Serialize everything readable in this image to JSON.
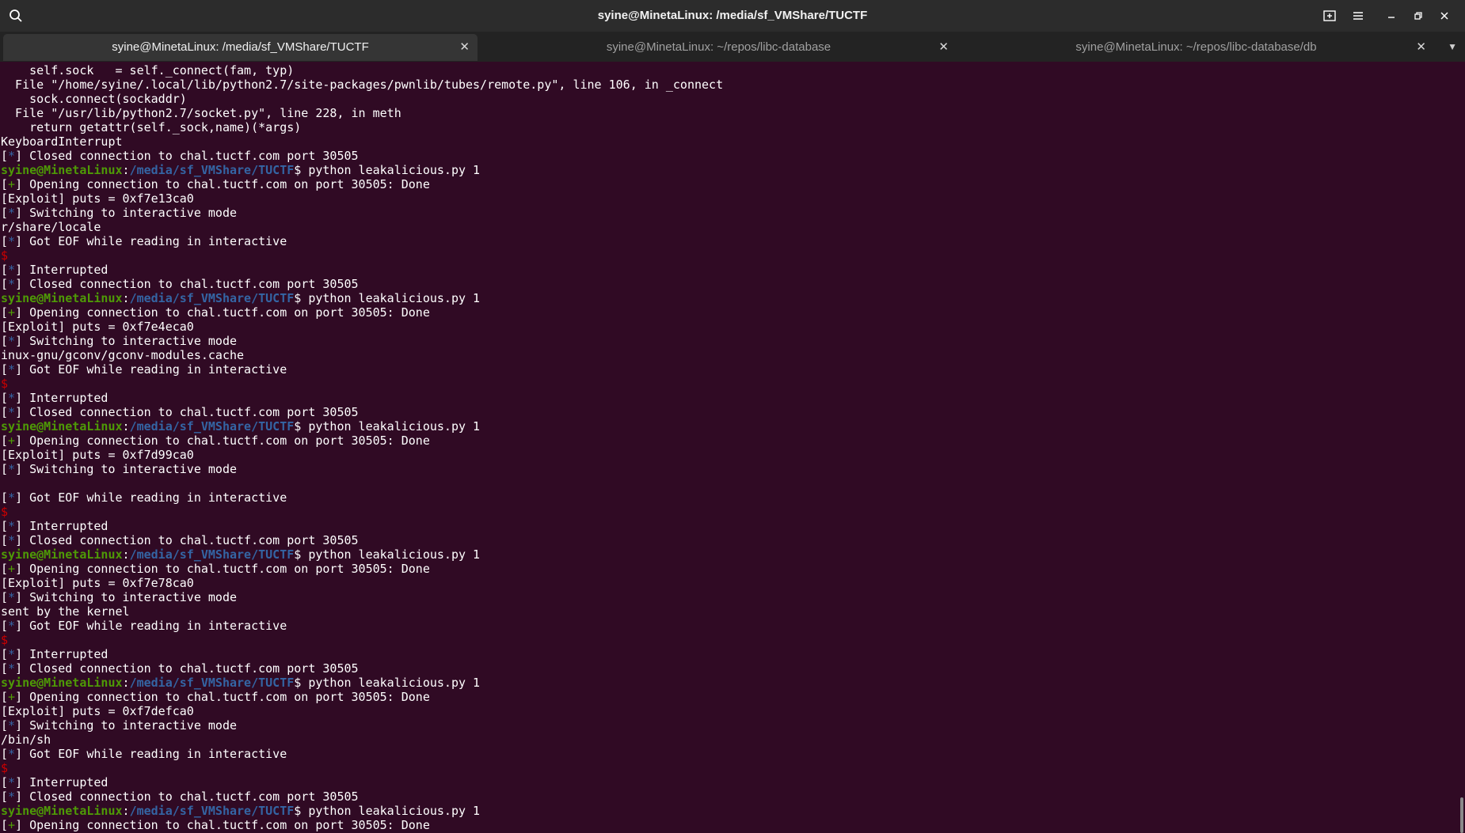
{
  "window": {
    "title": "syine@MinetaLinux: /media/sf_VMShare/TUCTF"
  },
  "icons": {
    "search": "search-icon",
    "new_tab": "new-tab-icon",
    "menu": "hamburger-menu-icon",
    "minimize": "minimize-icon",
    "maximize": "maximize-icon",
    "close": "close-icon",
    "tab_list": "chevron-down-icon"
  },
  "tabs": [
    {
      "label": "syine@MinetaLinux: /media/sf_VMShare/TUCTF",
      "active": true
    },
    {
      "label": "syine@MinetaLinux: ~/repos/libc-database",
      "active": false
    },
    {
      "label": "syine@MinetaLinux: ~/repos/libc-database/db",
      "active": false
    }
  ],
  "colors": {
    "background": "#300a24",
    "prompt_user": "#4e9a06",
    "prompt_path": "#3465a4",
    "status_plus": "#4e9a06",
    "status_star": "#3465a4",
    "shell_dollar": "#cc0000"
  },
  "prompt": {
    "user": "syine@MinetaLinux",
    "path": "/media/sf_VMShare/TUCTF",
    "command": "python leakalicious.py 1"
  },
  "terminal": {
    "lines": [
      {
        "kind": "plain",
        "text": "    self.sock   = self._connect(fam, typ)"
      },
      {
        "kind": "plain",
        "text": "  File \"/home/syine/.local/lib/python2.7/site-packages/pwnlib/tubes/remote.py\", line 106, in _connect"
      },
      {
        "kind": "plain",
        "text": "    sock.connect(sockaddr)"
      },
      {
        "kind": "plain",
        "text": "  File \"/usr/lib/python2.7/socket.py\", line 228, in meth"
      },
      {
        "kind": "plain",
        "text": "    return getattr(self._sock,name)(*args)"
      },
      {
        "kind": "plain",
        "text": "KeyboardInterrupt"
      },
      {
        "kind": "star",
        "text": "Closed connection to chal.tuctf.com port 30505"
      },
      {
        "kind": "prompt"
      },
      {
        "kind": "plus",
        "text": "Opening connection to chal.tuctf.com on port 30505: Done"
      },
      {
        "kind": "plain",
        "text": "[Exploit] puts = 0xf7e13ca0"
      },
      {
        "kind": "star",
        "text": "Switching to interactive mode"
      },
      {
        "kind": "plain",
        "text": "r/share/locale"
      },
      {
        "kind": "star",
        "text": "Got EOF while reading in interactive"
      },
      {
        "kind": "dollar",
        "text": "$"
      },
      {
        "kind": "star",
        "text": "Interrupted"
      },
      {
        "kind": "star",
        "text": "Closed connection to chal.tuctf.com port 30505"
      },
      {
        "kind": "prompt"
      },
      {
        "kind": "plus",
        "text": "Opening connection to chal.tuctf.com on port 30505: Done"
      },
      {
        "kind": "plain",
        "text": "[Exploit] puts = 0xf7e4eca0"
      },
      {
        "kind": "star",
        "text": "Switching to interactive mode"
      },
      {
        "kind": "plain",
        "text": "inux-gnu/gconv/gconv-modules.cache"
      },
      {
        "kind": "star",
        "text": "Got EOF while reading in interactive"
      },
      {
        "kind": "dollar",
        "text": "$"
      },
      {
        "kind": "star",
        "text": "Interrupted"
      },
      {
        "kind": "star",
        "text": "Closed connection to chal.tuctf.com port 30505"
      },
      {
        "kind": "prompt"
      },
      {
        "kind": "plus",
        "text": "Opening connection to chal.tuctf.com on port 30505: Done"
      },
      {
        "kind": "plain",
        "text": "[Exploit] puts = 0xf7d99ca0"
      },
      {
        "kind": "star",
        "text": "Switching to interactive mode"
      },
      {
        "kind": "plain",
        "text": ""
      },
      {
        "kind": "star",
        "text": "Got EOF while reading in interactive"
      },
      {
        "kind": "dollar",
        "text": "$"
      },
      {
        "kind": "star",
        "text": "Interrupted"
      },
      {
        "kind": "star",
        "text": "Closed connection to chal.tuctf.com port 30505"
      },
      {
        "kind": "prompt"
      },
      {
        "kind": "plus",
        "text": "Opening connection to chal.tuctf.com on port 30505: Done"
      },
      {
        "kind": "plain",
        "text": "[Exploit] puts = 0xf7e78ca0"
      },
      {
        "kind": "star",
        "text": "Switching to interactive mode"
      },
      {
        "kind": "plain",
        "text": "sent by the kernel"
      },
      {
        "kind": "star",
        "text": "Got EOF while reading in interactive"
      },
      {
        "kind": "dollar",
        "text": "$"
      },
      {
        "kind": "star",
        "text": "Interrupted"
      },
      {
        "kind": "star",
        "text": "Closed connection to chal.tuctf.com port 30505"
      },
      {
        "kind": "prompt"
      },
      {
        "kind": "plus",
        "text": "Opening connection to chal.tuctf.com on port 30505: Done"
      },
      {
        "kind": "plain",
        "text": "[Exploit] puts = 0xf7defca0"
      },
      {
        "kind": "star",
        "text": "Switching to interactive mode"
      },
      {
        "kind": "plain",
        "text": "/bin/sh"
      },
      {
        "kind": "star",
        "text": "Got EOF while reading in interactive"
      },
      {
        "kind": "dollar",
        "text": "$"
      },
      {
        "kind": "star",
        "text": "Interrupted"
      },
      {
        "kind": "star",
        "text": "Closed connection to chal.tuctf.com port 30505"
      },
      {
        "kind": "prompt"
      },
      {
        "kind": "plus",
        "text": "Opening connection to chal.tuctf.com on port 30505: Done"
      }
    ]
  }
}
